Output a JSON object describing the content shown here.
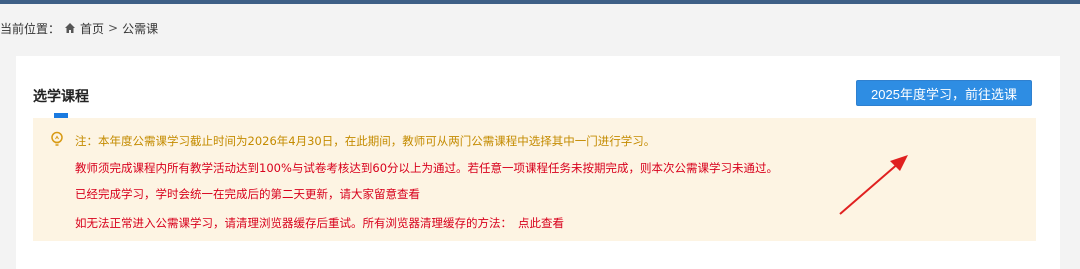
{
  "breadcrumb": {
    "label": "当前位置：",
    "home": "首页",
    "separator": ">",
    "current": "公需课"
  },
  "section": {
    "title": "选学课程"
  },
  "select_button": {
    "label": "2025年度学习，前往选课"
  },
  "notice": {
    "line1": "注：本年度公需课学习截止时间为2026年4月30日，在此期间，教师可从两门公需课程中选择其中一门进行学习。",
    "line2": "教师须完成课程内所有教学活动达到100%与试卷考核达到60分以上为通过。若任意一项课程任务未按期完成，则本次公需课学习未通过。",
    "line3": "已经完成学习，学时会统一在完成后的第二天更新，请大家留意查看",
    "line4": "如无法正常进入公需课学习，请清理浏览器缓存后重试。所有浏览器清理缓存的方法：",
    "link": "点此查看"
  },
  "colors": {
    "accent": "#2e8de3",
    "notice_bg": "#fdf4e3",
    "warning_text": "#d8001c",
    "note_text": "#c48b00",
    "annotation_arrow": "#e02020"
  },
  "icons": {
    "home": "home-icon",
    "notice": "bulb-icon"
  }
}
